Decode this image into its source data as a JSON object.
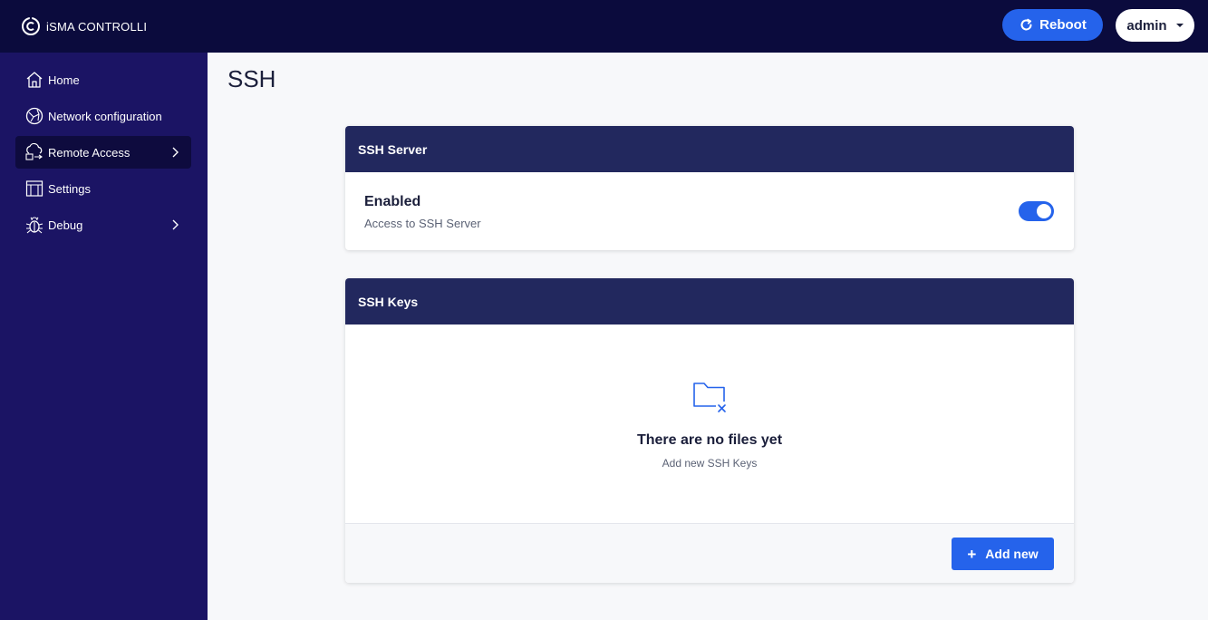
{
  "brand": {
    "name": "iSMA CONTROLLI",
    "icon": "brand-logo-icon"
  },
  "header": {
    "reboot_label": "Reboot",
    "reboot_icon": "refresh-icon",
    "user_label": "admin",
    "user_icon": "chevron-down-icon"
  },
  "sidebar": {
    "items": [
      {
        "label": "Home",
        "icon": "home-icon",
        "active": false,
        "has_submenu": false
      },
      {
        "label": "Network configuration",
        "icon": "network-icon",
        "active": false,
        "has_submenu": false
      },
      {
        "label": "Remote Access",
        "icon": "remote-access-icon",
        "active": true,
        "has_submenu": true
      },
      {
        "label": "Settings",
        "icon": "settings-icon",
        "active": false,
        "has_submenu": false
      },
      {
        "label": "Debug",
        "icon": "bug-icon",
        "active": false,
        "has_submenu": true
      }
    ]
  },
  "page": {
    "title": "SSH"
  },
  "ssh_server": {
    "header": "SSH Server",
    "enabled_title": "Enabled",
    "enabled_desc": "Access to SSH Server",
    "enabled": true
  },
  "ssh_keys": {
    "header": "SSH Keys",
    "empty_icon": "folder-x-icon",
    "empty_title": "There are no files yet",
    "empty_subtitle": "Add new SSH Keys",
    "add_label": "Add new"
  },
  "colors": {
    "accent": "#2563eb",
    "topbar": "#0b0b3d",
    "sidebar": "#1b1464",
    "card_header": "#22285e"
  }
}
